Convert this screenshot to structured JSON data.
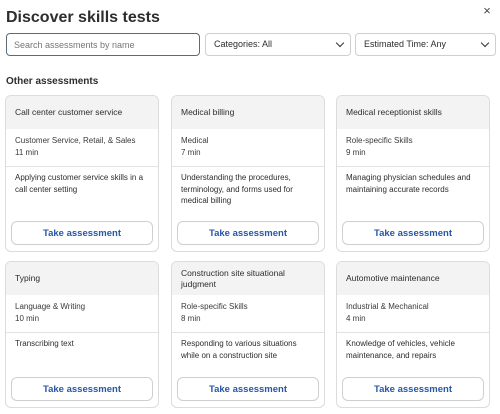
{
  "header": {
    "title": "Discover skills tests",
    "close_glyph": "×"
  },
  "filters": {
    "search_placeholder": "Search assessments by name",
    "categories_label": "Categories: All",
    "time_label": "Estimated Time: Any"
  },
  "section": {
    "title": "Other assessments"
  },
  "cards": [
    {
      "name": "Call center customer service",
      "category": "Customer Service, Retail, & Sales",
      "duration": "11 min",
      "description": "Applying customer service skills in a call center setting",
      "button": "Take assessment"
    },
    {
      "name": "Medical billing",
      "category": "Medical",
      "duration": "7 min",
      "description": "Understanding the procedures, terminology, and forms used for medical billing",
      "button": "Take assessment"
    },
    {
      "name": "Medical receptionist skills",
      "category": "Role-specific Skills",
      "duration": "9 min",
      "description": "Managing physician schedules and maintaining accurate records",
      "button": "Take assessment"
    },
    {
      "name": "Typing",
      "category": "Language & Writing",
      "duration": "10 min",
      "description": "Transcribing text",
      "button": "Take assessment"
    },
    {
      "name": "Construction site situational judgment",
      "category": "Role-specific Skills",
      "duration": "8 min",
      "description": "Responding to various situations while on a construction site",
      "button": "Take assessment"
    },
    {
      "name": "Automotive maintenance",
      "category": "Industrial & Mechanical",
      "duration": "4 min",
      "description": "Knowledge of vehicles, vehicle maintenance, and repairs",
      "button": "Take assessment"
    }
  ]
}
